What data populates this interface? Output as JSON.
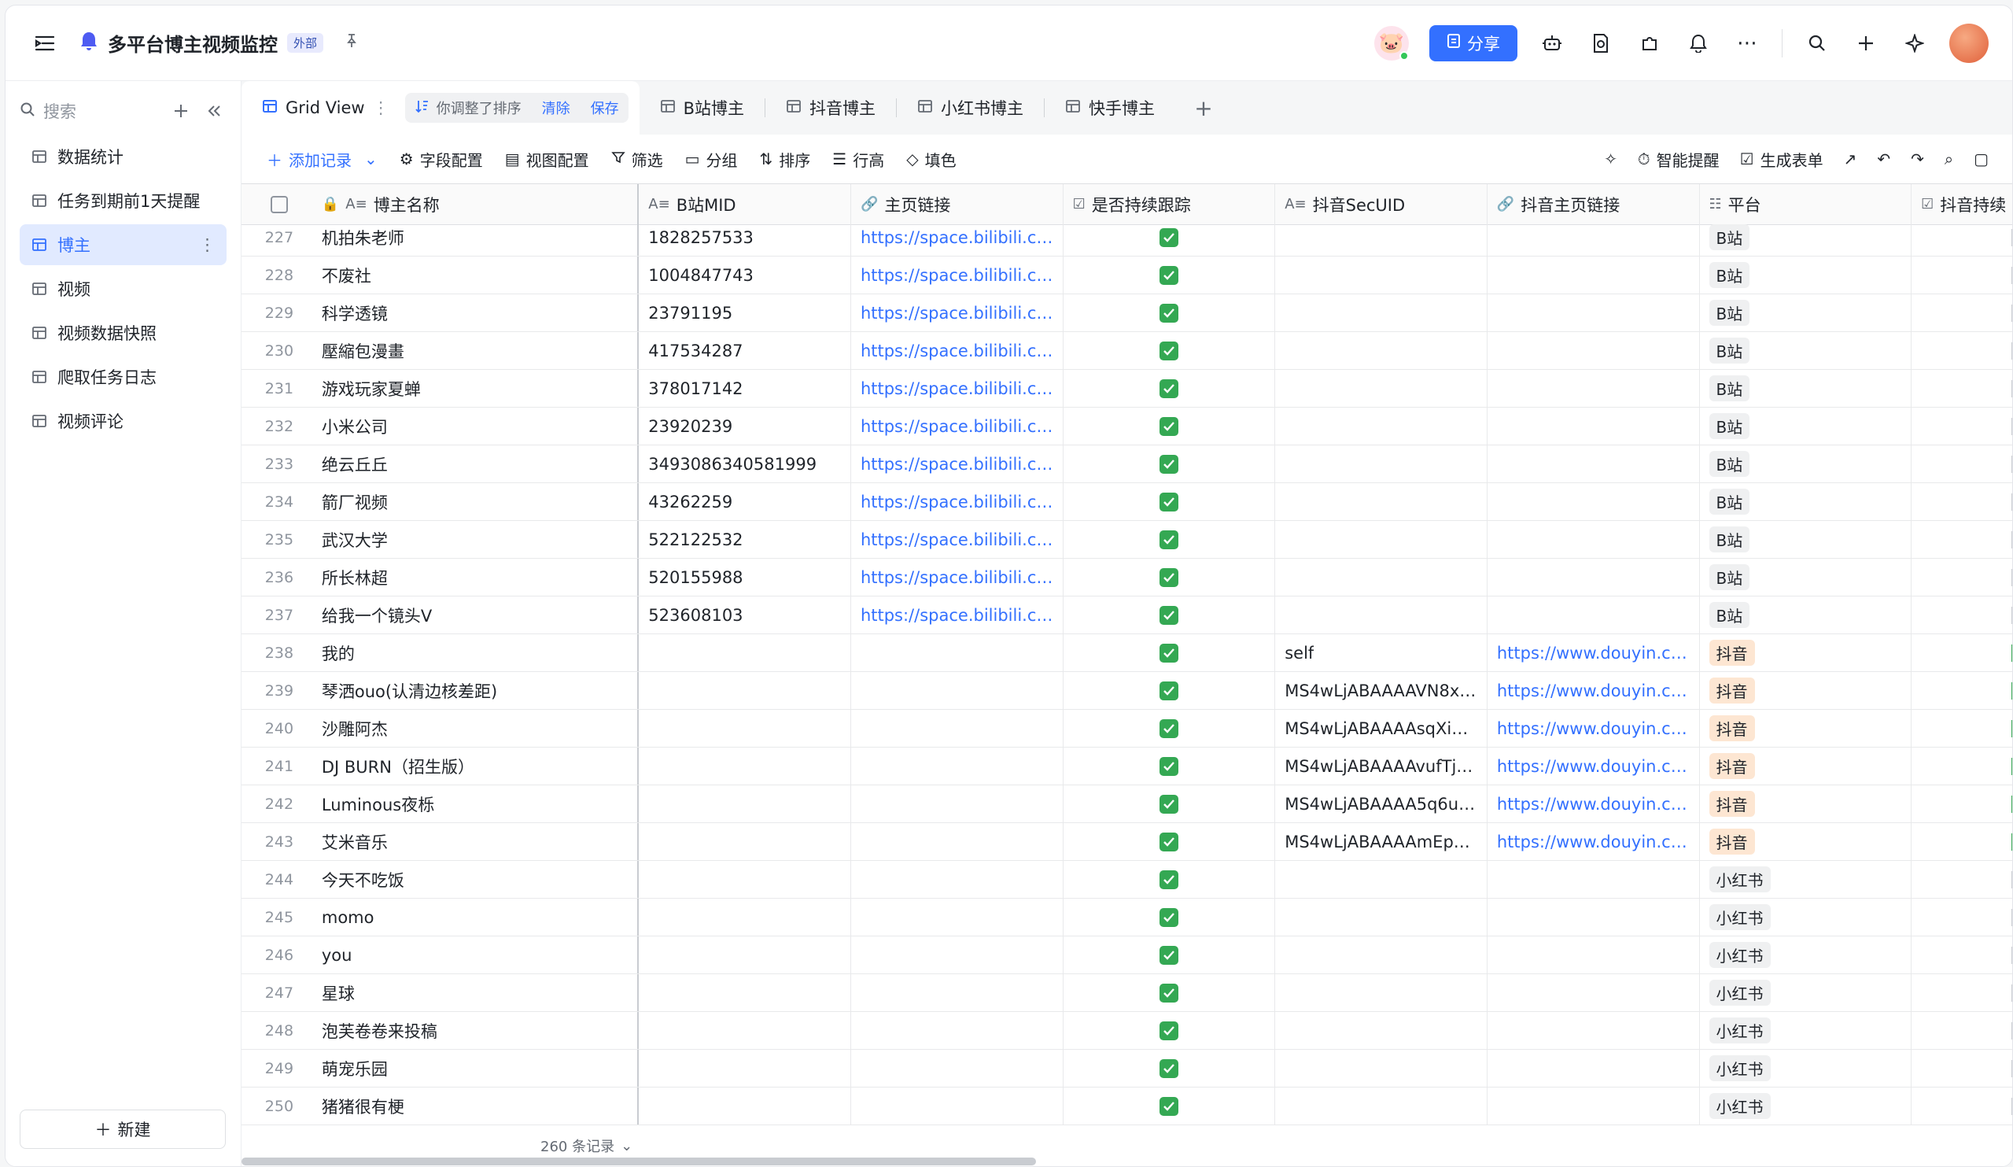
{
  "app": {
    "title": "多平台博主视频监控",
    "badge": "外部",
    "share_label": "分享"
  },
  "sidebar": {
    "search_placeholder": "搜索",
    "items": [
      {
        "label": "数据统计",
        "icon": "dashboard-icon"
      },
      {
        "label": "任务到期前1天提醒",
        "icon": "workflow-icon"
      },
      {
        "label": "博主",
        "icon": "table-icon",
        "active": true
      },
      {
        "label": "视频",
        "icon": "table-icon"
      },
      {
        "label": "视频数据快照",
        "icon": "table-icon"
      },
      {
        "label": "爬取任务日志",
        "icon": "table-icon"
      },
      {
        "label": "视频评论",
        "icon": "table-icon"
      }
    ],
    "new_label": "新建"
  },
  "tabs": {
    "active": "Grid View",
    "sort_note": "你调整了排序",
    "clear": "清除",
    "save": "保存",
    "others": [
      "B站博主",
      "抖音博主",
      "小红书博主",
      "快手博主"
    ]
  },
  "toolbar": {
    "add_record": "添加记录",
    "field_config": "字段配置",
    "view_config": "视图配置",
    "filter": "筛选",
    "group": "分组",
    "sort": "排序",
    "row_height": "行高",
    "fill_color": "填色",
    "smart_remind": "智能提醒",
    "gen_form": "生成表单"
  },
  "columns": [
    "博主名称",
    "B站MID",
    "主页链接",
    "是否持续跟踪",
    "抖音SecUID",
    "抖音主页链接",
    "平台",
    "抖音持续"
  ],
  "rows": [
    {
      "n": "227",
      "name": "机拍朱老师",
      "mid": "1828257533",
      "url": "https://space.bilibili.com...",
      "sec": "",
      "dy": "",
      "plat": "B站",
      "pt": "b"
    },
    {
      "n": "228",
      "name": "不废社",
      "mid": "1004847743",
      "url": "https://space.bilibili.com...",
      "sec": "",
      "dy": "",
      "plat": "B站",
      "pt": "b"
    },
    {
      "n": "229",
      "name": "科学透镜",
      "mid": "23791195",
      "url": "https://space.bilibili.com...",
      "sec": "",
      "dy": "",
      "plat": "B站",
      "pt": "b"
    },
    {
      "n": "230",
      "name": "壓縮包漫畫",
      "mid": "417534287",
      "url": "https://space.bilibili.com...",
      "sec": "",
      "dy": "",
      "plat": "B站",
      "pt": "b"
    },
    {
      "n": "231",
      "name": "游戏玩家夏蝉",
      "mid": "378017142",
      "url": "https://space.bilibili.com...",
      "sec": "",
      "dy": "",
      "plat": "B站",
      "pt": "b"
    },
    {
      "n": "232",
      "name": "小米公司",
      "mid": "23920239",
      "url": "https://space.bilibili.com...",
      "sec": "",
      "dy": "",
      "plat": "B站",
      "pt": "b"
    },
    {
      "n": "233",
      "name": "绝云丘丘",
      "mid": "3493086340581999",
      "url": "https://space.bilibili.com...",
      "sec": "",
      "dy": "",
      "plat": "B站",
      "pt": "b"
    },
    {
      "n": "234",
      "name": "箭厂视频",
      "mid": "43262259",
      "url": "https://space.bilibili.com...",
      "sec": "",
      "dy": "",
      "plat": "B站",
      "pt": "b"
    },
    {
      "n": "235",
      "name": "武汉大学",
      "mid": "522122532",
      "url": "https://space.bilibili.com...",
      "sec": "",
      "dy": "",
      "plat": "B站",
      "pt": "b"
    },
    {
      "n": "236",
      "name": "所长林超",
      "mid": "520155988",
      "url": "https://space.bilibili.com...",
      "sec": "",
      "dy": "",
      "plat": "B站",
      "pt": "b"
    },
    {
      "n": "237",
      "name": "给我一个镜头V",
      "mid": "523608103",
      "url": "https://space.bilibili.com...",
      "sec": "",
      "dy": "",
      "plat": "B站",
      "pt": "b"
    },
    {
      "n": "238",
      "name": "我的",
      "mid": "",
      "url": "",
      "sec": "self",
      "dy": "https://www.douyin.co...",
      "plat": "抖音",
      "pt": "dy"
    },
    {
      "n": "239",
      "name": "琴洒ouo(认清边核差距)",
      "mid": "",
      "url": "",
      "sec": "MS4wLjABAAAAVN8xte...",
      "dy": "https://www.douyin.co...",
      "plat": "抖音",
      "pt": "dy"
    },
    {
      "n": "240",
      "name": "沙雕阿杰",
      "mid": "",
      "url": "",
      "sec": "MS4wLjABAAAAsqXiGOR...",
      "dy": "https://www.douyin.co...",
      "plat": "抖音",
      "pt": "dy"
    },
    {
      "n": "241",
      "name": "DJ BURN（招生版）",
      "mid": "",
      "url": "",
      "sec": "MS4wLjABAAAAvufTjm6...",
      "dy": "https://www.douyin.co...",
      "plat": "抖音",
      "pt": "dy"
    },
    {
      "n": "242",
      "name": "Luminous夜栎",
      "mid": "",
      "url": "",
      "sec": "MS4wLjABAAAA5q6uALl...",
      "dy": "https://www.douyin.co...",
      "plat": "抖音",
      "pt": "dy"
    },
    {
      "n": "243",
      "name": "艾米音乐",
      "mid": "",
      "url": "",
      "sec": "MS4wLjABAAAAmEpSy6...",
      "dy": "https://www.douyin.co...",
      "plat": "抖音",
      "pt": "dy"
    },
    {
      "n": "244",
      "name": "今天不吃饭",
      "mid": "",
      "url": "",
      "sec": "",
      "dy": "",
      "plat": "小红书",
      "pt": "x"
    },
    {
      "n": "245",
      "name": "momo",
      "mid": "",
      "url": "",
      "sec": "",
      "dy": "",
      "plat": "小红书",
      "pt": "x"
    },
    {
      "n": "246",
      "name": "you",
      "mid": "",
      "url": "",
      "sec": "",
      "dy": "",
      "plat": "小红书",
      "pt": "x"
    },
    {
      "n": "247",
      "name": "星球",
      "mid": "",
      "url": "",
      "sec": "",
      "dy": "",
      "plat": "小红书",
      "pt": "x"
    },
    {
      "n": "248",
      "name": "泡芙卷卷来投稿",
      "mid": "",
      "url": "",
      "sec": "",
      "dy": "",
      "plat": "小红书",
      "pt": "x"
    },
    {
      "n": "249",
      "name": "萌宠乐园",
      "mid": "",
      "url": "",
      "sec": "",
      "dy": "",
      "plat": "小红书",
      "pt": "x"
    },
    {
      "n": "250",
      "name": "猪猪很有梗",
      "mid": "",
      "url": "",
      "sec": "",
      "dy": "",
      "plat": "小红书",
      "pt": "x"
    }
  ],
  "footer": {
    "count": "260 条记录"
  },
  "colors": {
    "accent": "#3370ff",
    "check": "#34a853",
    "douyin_tag": "#fde6d2"
  }
}
